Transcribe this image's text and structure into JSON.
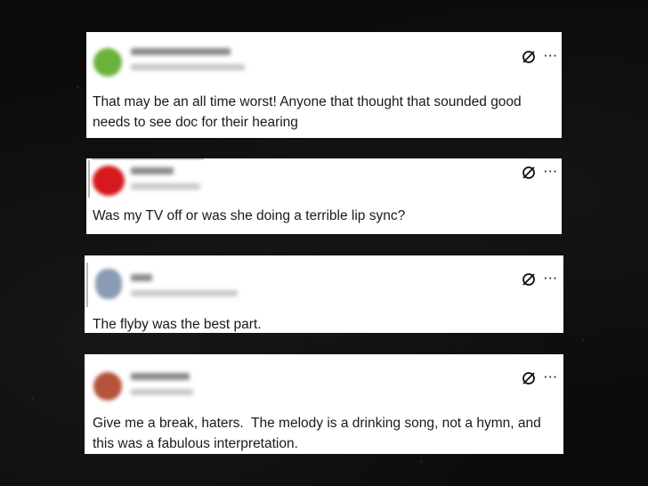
{
  "tweets": [
    {
      "text": "That may be an all time worst! Anyone that thought that sounded good needs to see doc for their hearing",
      "icons": {
        "status": "unavailable-icon",
        "menu": "more-options-icon"
      },
      "avatar_color": "#6bb23a"
    },
    {
      "text": "Was my TV off or was she doing a terrible lip sync?",
      "icons": {
        "status": "unavailable-icon",
        "menu": "more-options-icon"
      },
      "avatar_color": "#d6191c"
    },
    {
      "text": "The flyby was the best part.",
      "icons": {
        "status": "unavailable-icon",
        "menu": "more-options-icon"
      },
      "avatar_color": "#8a9bb3"
    },
    {
      "text": "Give me a break, haters.  The melody is a drinking song, not a hymn, and this was a fabulous interpretation.",
      "icons": {
        "status": "unavailable-icon",
        "menu": "more-options-icon"
      },
      "avatar_color": "#b5543a"
    }
  ],
  "more_symbol": "···"
}
